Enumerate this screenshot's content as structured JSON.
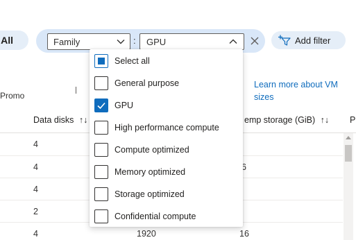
{
  "filter_bar": {
    "all_label": "All",
    "filter_field": "Family",
    "separator": ":",
    "filter_value": "GPU",
    "add_filter_label": "Add filter"
  },
  "dropdown": {
    "options": [
      {
        "label": "Select all",
        "state": "partial"
      },
      {
        "label": "General purpose",
        "state": "unchecked"
      },
      {
        "label": "GPU",
        "state": "checked"
      },
      {
        "label": "High performance compute",
        "state": "unchecked"
      },
      {
        "label": "Compute optimized",
        "state": "unchecked"
      },
      {
        "label": "Memory optimized",
        "state": "unchecked"
      },
      {
        "label": "Storage optimized",
        "state": "unchecked"
      },
      {
        "label": "Confidential compute",
        "state": "unchecked"
      }
    ]
  },
  "background": {
    "promo_label": "Promo",
    "learn_link": "Learn more about VM sizes",
    "columns": {
      "data_disks": "Data disks",
      "temp_storage": "emp storage (GiB)",
      "partial": "P",
      "sort_icon": "↑↓"
    },
    "rows": [
      {
        "data_disks": "4",
        "mid": "",
        "temp": ""
      },
      {
        "data_disks": "4",
        "mid": "",
        "temp": "6"
      },
      {
        "data_disks": "4",
        "mid": "",
        "temp": ""
      },
      {
        "data_disks": "2",
        "mid": "",
        "temp": ""
      },
      {
        "data_disks": "4",
        "mid": "1920",
        "temp": "16"
      }
    ]
  },
  "colors": {
    "accent": "#0f6cbd",
    "pill_bg": "#d9e7f8"
  }
}
